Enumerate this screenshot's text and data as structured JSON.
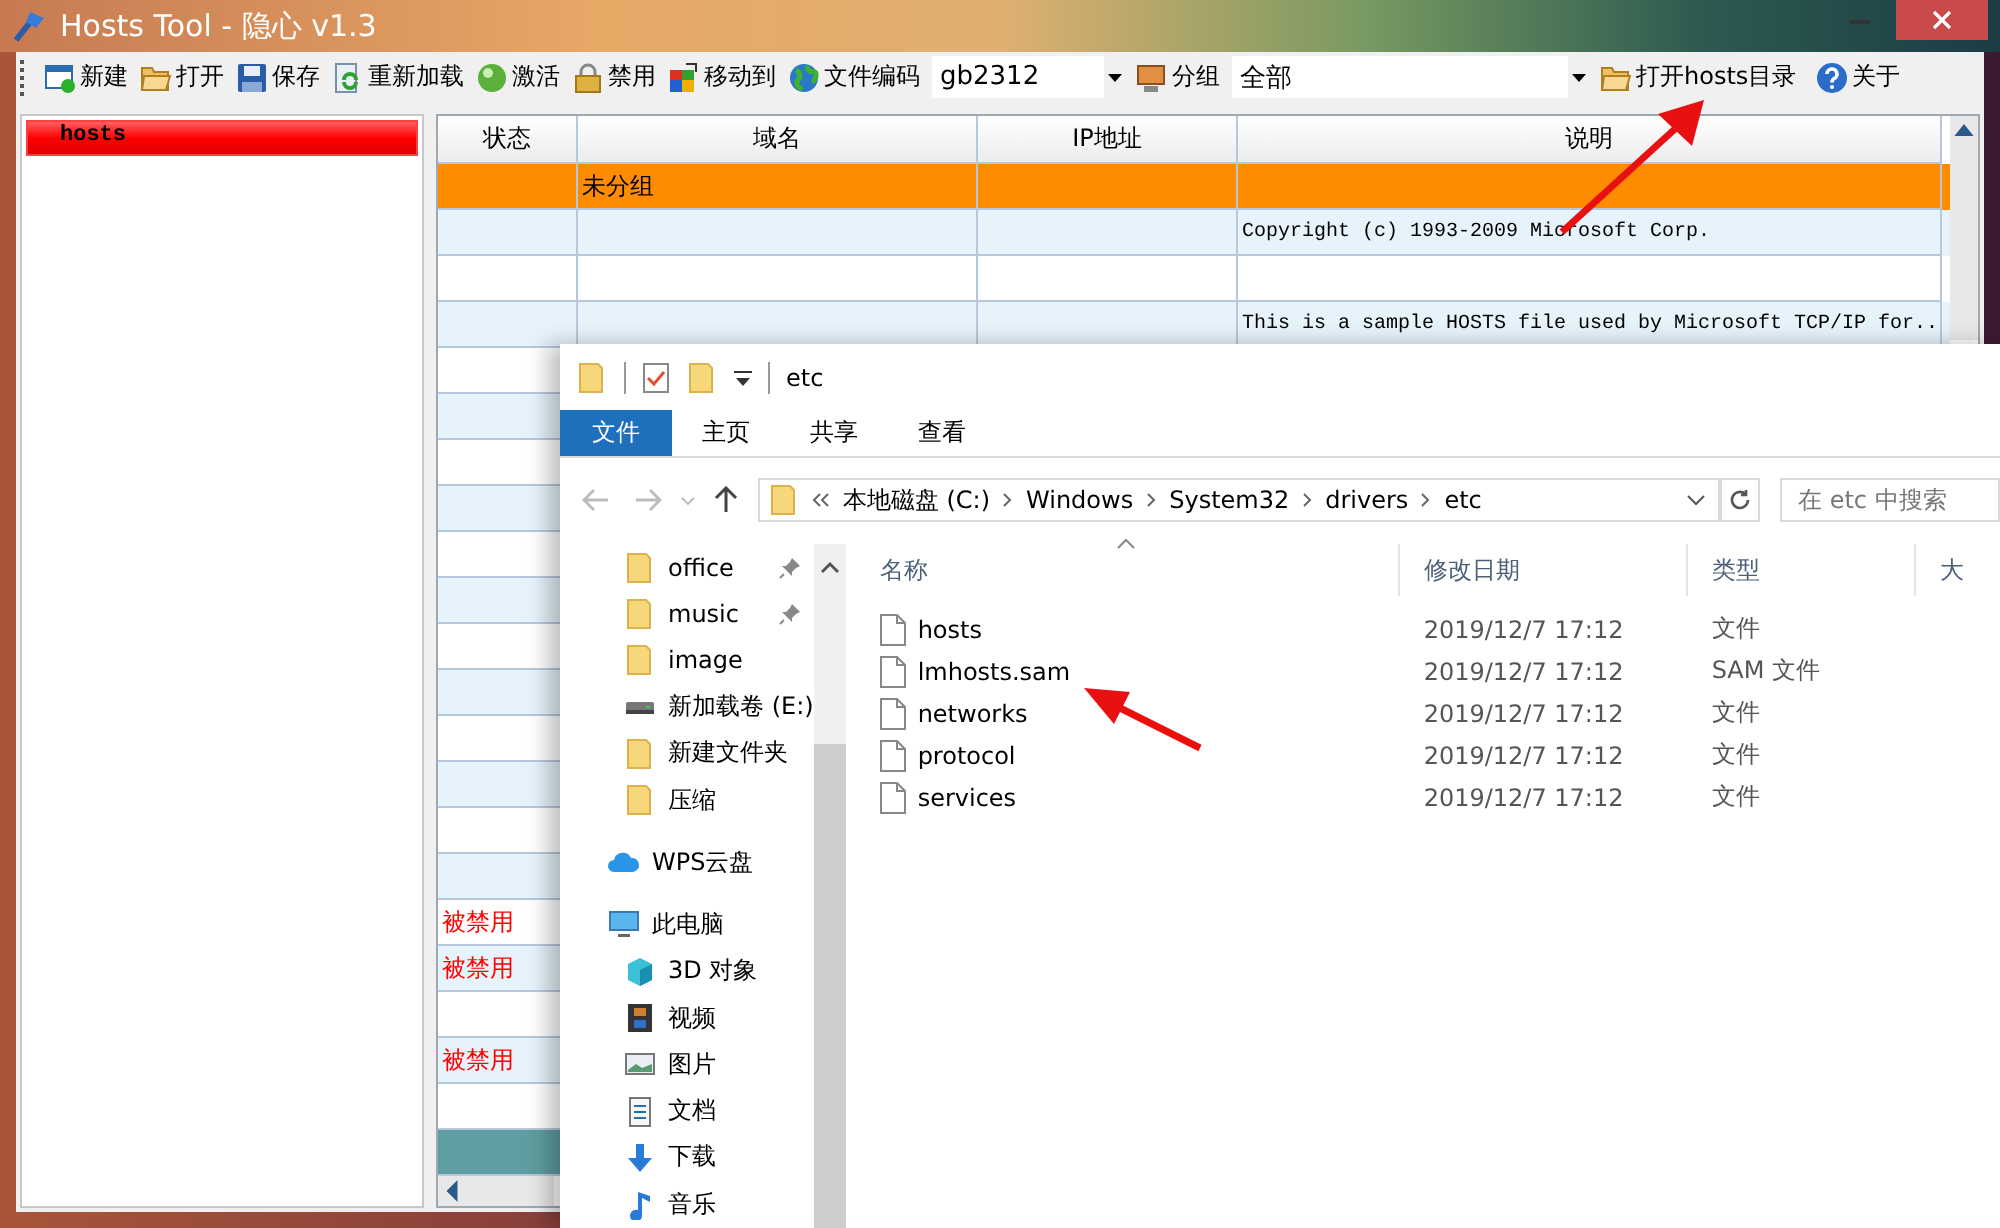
{
  "window": {
    "title": "Hosts Tool - 隐心 v1.3"
  },
  "toolbar": {
    "buttons": [
      {
        "label": "新建",
        "kind": "new"
      },
      {
        "label": "打开",
        "kind": "open"
      },
      {
        "label": "保存",
        "kind": "save"
      },
      {
        "label": "重新加载",
        "kind": "reload"
      },
      {
        "label": "激活",
        "kind": "activate"
      },
      {
        "label": "禁用",
        "kind": "lock"
      },
      {
        "label": "移动到",
        "kind": "move"
      },
      {
        "label": "文件编码",
        "kind": "globe"
      }
    ],
    "encoding": "gb2312",
    "group_button": {
      "label": "分组",
      "kind": "group"
    },
    "group_value": "全部",
    "buttons_right": [
      {
        "label": "打开hosts目录",
        "kind": "open"
      },
      {
        "label": "关于",
        "kind": "help"
      }
    ]
  },
  "sidebar": {
    "items": [
      {
        "label": "hosts",
        "selected": true
      }
    ]
  },
  "table": {
    "columns": [
      "状态",
      "域名",
      "IP地址",
      "说明"
    ],
    "rows": [
      {
        "kind": "group",
        "domain": "未分组",
        "selected": false
      },
      {
        "kind": "entry",
        "note": "Copyright (c) 1993-2009 Microsoft Corp.",
        "selected": false
      },
      {
        "kind": "entry",
        "selected": false
      },
      {
        "kind": "entry",
        "note": "This is a sample HOSTS file used by Microsoft TCP/IP for..",
        "selected": false
      },
      {
        "kind": "entry",
        "selected": false
      },
      {
        "kind": "entry",
        "selected": false
      },
      {
        "kind": "entry",
        "selected": false
      },
      {
        "kind": "entry",
        "selected": false
      },
      {
        "kind": "entry",
        "selected": false
      },
      {
        "kind": "entry",
        "selected": false
      },
      {
        "kind": "entry",
        "selected": false
      },
      {
        "kind": "entry",
        "selected": false
      },
      {
        "kind": "entry",
        "selected": false
      },
      {
        "kind": "entry",
        "selected": false
      },
      {
        "kind": "entry",
        "selected": false
      },
      {
        "kind": "entry",
        "selected": false
      },
      {
        "kind": "entry",
        "status": "被禁用",
        "selected": false
      },
      {
        "kind": "entry",
        "status": "被禁用",
        "selected": false
      },
      {
        "kind": "entry",
        "selected": false
      },
      {
        "kind": "entry",
        "status": "被禁用",
        "selected": false
      },
      {
        "kind": "entry",
        "selected": false
      },
      {
        "kind": "entry",
        "selected": true
      }
    ]
  },
  "explorer": {
    "title": "etc",
    "ribbon_tabs": [
      {
        "label": "文件",
        "selected": true
      },
      {
        "label": "主页",
        "selected": false
      },
      {
        "label": "共享",
        "selected": false
      },
      {
        "label": "查看",
        "selected": false
      }
    ],
    "breadcrumb": [
      "本地磁盘 (C:)",
      "Windows",
      "System32",
      "drivers",
      "etc"
    ],
    "search": {
      "placeholder": "在 etc 中搜索"
    },
    "nav": [
      {
        "label": "office",
        "kind": "folder",
        "pinned": true
      },
      {
        "label": "music",
        "kind": "folder",
        "pinned": true
      },
      {
        "label": "image",
        "kind": "folder",
        "pinned": false
      },
      {
        "label": "新加载卷 (E:)",
        "kind": "drive",
        "pinned": false
      },
      {
        "label": "新建文件夹",
        "kind": "folder",
        "pinned": false
      },
      {
        "label": "压缩",
        "kind": "folder",
        "pinned": false
      },
      {
        "label": "WPS云盘",
        "kind": "cloud",
        "pinned": false
      },
      {
        "label": "此电脑",
        "kind": "pc",
        "pinned": false,
        "children": [
          {
            "label": "3D 对象",
            "kind": "cube",
            "pinned": false
          },
          {
            "label": "视频",
            "kind": "video",
            "pinned": false
          },
          {
            "label": "图片",
            "kind": "picture",
            "pinned": false
          },
          {
            "label": "文档",
            "kind": "doc",
            "pinned": false
          },
          {
            "label": "下载",
            "kind": "download",
            "pinned": false
          },
          {
            "label": "音乐",
            "kind": "music",
            "pinned": false
          }
        ]
      }
    ],
    "columns": [
      "名称",
      "修改日期",
      "类型",
      "大"
    ],
    "files": [
      {
        "name": "hosts",
        "modified": "2019/12/7 17:12",
        "type": "文件"
      },
      {
        "name": "lmhosts.sam",
        "modified": "2019/12/7 17:12",
        "type": "SAM 文件"
      },
      {
        "name": "networks",
        "modified": "2019/12/7 17:12",
        "type": "文件"
      },
      {
        "name": "protocol",
        "modified": "2019/12/7 17:12",
        "type": "文件"
      },
      {
        "name": "services",
        "modified": "2019/12/7 17:12",
        "type": "文件"
      }
    ]
  }
}
